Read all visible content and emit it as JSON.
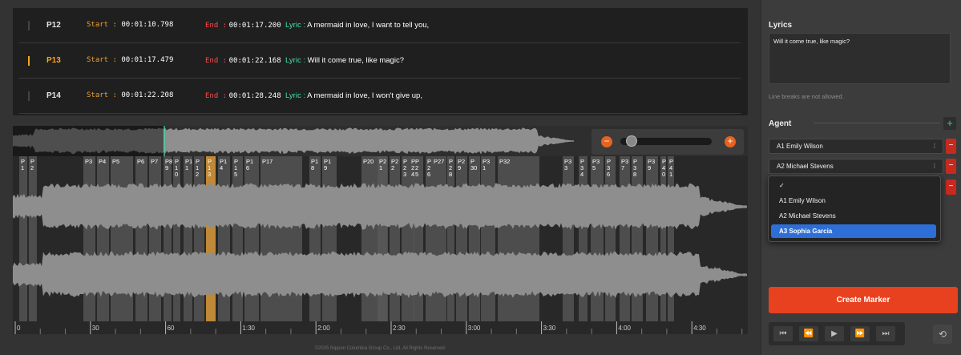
{
  "lyric_rows": [
    {
      "id": "P12",
      "start_label": "Start :",
      "start": "00:01:10.798",
      "end_label": "End :",
      "end": "00:01:17.200",
      "lyric_label": "Lyric :",
      "lyric": "A mermaid in love, I want to tell you,",
      "active": false
    },
    {
      "id": "P13",
      "start_label": "Start :",
      "start": "00:01:17.479",
      "end_label": "End :",
      "end": "00:01:22.168",
      "lyric_label": "Lyric :",
      "lyric": "Will it come true, like magic?",
      "active": true
    },
    {
      "id": "P14",
      "start_label": "Start :",
      "start": "00:01:22.208",
      "end_label": "End :",
      "end": "00:01:28.248",
      "lyric_label": "Lyric :",
      "lyric": "A mermaid in love, I won't give up,",
      "active": false
    }
  ],
  "waveform": {
    "markers": [
      {
        "label": "P\n1"
      },
      {
        "label": "P\n2"
      },
      {
        "label": "P3"
      },
      {
        "label": "P4"
      },
      {
        "label": "P5"
      },
      {
        "label": "P6"
      },
      {
        "label": "P7"
      },
      {
        "label": "P8\n9"
      },
      {
        "label": "P\n1\n0"
      },
      {
        "label": "P1\n1"
      },
      {
        "label": "P\n1\n2"
      },
      {
        "label": "P\n1\n3"
      },
      {
        "label": "P1\n4"
      },
      {
        "label": "P\n1\n5"
      },
      {
        "label": "P1\n6"
      },
      {
        "label": "P17"
      },
      {
        "label": "P1\n8"
      },
      {
        "label": "P1\n9"
      },
      {
        "label": "P20"
      },
      {
        "label": "P2\n1"
      },
      {
        "label": "P2\n2"
      },
      {
        "label": "P\n2\n3"
      },
      {
        "label": "P\n2\n4"
      },
      {
        "label": "P\n2\n5"
      },
      {
        "label": "P\n2\n6"
      },
      {
        "label": "P27"
      },
      {
        "label": "P\n2\n8"
      },
      {
        "label": "P2\n9"
      },
      {
        "label": "P\n30"
      },
      {
        "label": "P3\n1"
      },
      {
        "label": "P32"
      },
      {
        "label": "P3\n3"
      },
      {
        "label": "P\n3\n4"
      },
      {
        "label": "P3\n5"
      },
      {
        "label": "P\n3\n6"
      },
      {
        "label": "P3\n7"
      },
      {
        "label": "P\n3\n8"
      },
      {
        "label": "P3\n9"
      },
      {
        "label": "P\n4\n0"
      },
      {
        "label": "P\n4\n1"
      }
    ],
    "active_marker": "P13",
    "ruler": [
      "0",
      "30",
      "60",
      "1:30",
      "2:00",
      "2:30",
      "3:00",
      "3:30",
      "4:00",
      "4:30"
    ],
    "zoom_level": 0.07,
    "colors": {
      "playhead": "#3ee0b0",
      "active_marker": "#d99a3a"
    }
  },
  "footer": "©2025 Nippon Columbia Group Co., Ltd. All Rights Reserved.",
  "sidebar": {
    "lyrics_title": "Lyrics",
    "lyrics_value": "Will it come true, like magic?",
    "lyrics_hint": "Line breaks are not allowed.",
    "agent_title": "Agent",
    "agent_fields": [
      "A1 Emily Wilson",
      "A2 Michael Stevens"
    ],
    "dropdown_options": [
      "A1 Emily Wilson",
      "A2 Michael Stevens",
      "A3 Sophia Garcia"
    ],
    "dropdown_selected": "A3 Sophia Garcia",
    "create_marker": "Create Marker"
  },
  "colors": {
    "accent": "#e8411f",
    "start": "#f0a030",
    "end": "#ff4a4a",
    "lyric": "#3ee0b0",
    "selected": "#2d6fd6"
  }
}
